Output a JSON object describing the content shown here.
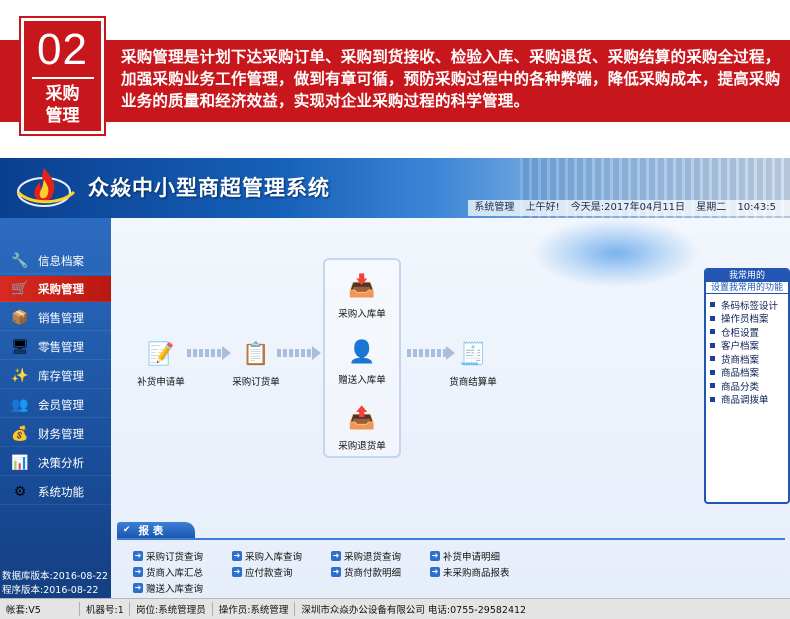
{
  "banner": {
    "number": "02",
    "title": "采购管理",
    "text": "采购管理是计划下达采购订单、采购到货接收、检验入库、采购退货、采购结算的采购全过程，加强采购业务工作管理，做到有章可循，预防采购过程中的各种弊端，降低采购成本，提高采购业务的质量和经济效益，实现对企业采购过程的科学管理。"
  },
  "app": {
    "title": "众焱中小型商超管理系统",
    "status_module": "系统管理",
    "status_greeting": "上午好!",
    "status_date": "今天是:2017年04月11日",
    "status_weekday": "星期二",
    "status_time": "10:43:5"
  },
  "sidebar": {
    "items": [
      {
        "label": "信息档案",
        "icon": "tools-icon"
      },
      {
        "label": "采购管理",
        "icon": "purchase-icon"
      },
      {
        "label": "销售管理",
        "icon": "sales-icon"
      },
      {
        "label": "零售管理",
        "icon": "retail-icon"
      },
      {
        "label": "库存管理",
        "icon": "inventory-icon"
      },
      {
        "label": "会员管理",
        "icon": "member-icon"
      },
      {
        "label": "财务管理",
        "icon": "finance-icon"
      },
      {
        "label": "决策分析",
        "icon": "analysis-icon"
      },
      {
        "label": "系统功能",
        "icon": "system-icon"
      }
    ],
    "db_version": "数据库版本:2016-08-22",
    "app_version": "程序版本:2016-08-22"
  },
  "flow": {
    "replenish": "补货申请单",
    "order": "采购订货单",
    "inbound": "采购入库单",
    "gift_inbound": "赠送入库单",
    "return": "采购退货单",
    "settlement": "货商结算单"
  },
  "favorites": {
    "header": "我常用的",
    "subheader": "设置我常用的功能",
    "items": [
      "条码标签设计",
      "操作员档案",
      "仓柜设置",
      "客户档案",
      "货商档案",
      "商品档案",
      "商品分类",
      "商品调拨单"
    ]
  },
  "reports": {
    "tab": "报  表",
    "items": [
      "采购订货查询",
      "采购入库查询",
      "采购退货查询",
      "补货申请明细",
      "货商入库汇总",
      "应付款查询",
      "货商付款明细",
      "未采购商品报表",
      "赠送入库查询"
    ]
  },
  "footer": {
    "account": "帐套:V5",
    "machine": "机器号:1",
    "position": "岗位:系统管理员",
    "operator": "操作员:系统管理",
    "company": "深圳市众焱办公设备有限公司 电话:0755-29582412"
  }
}
